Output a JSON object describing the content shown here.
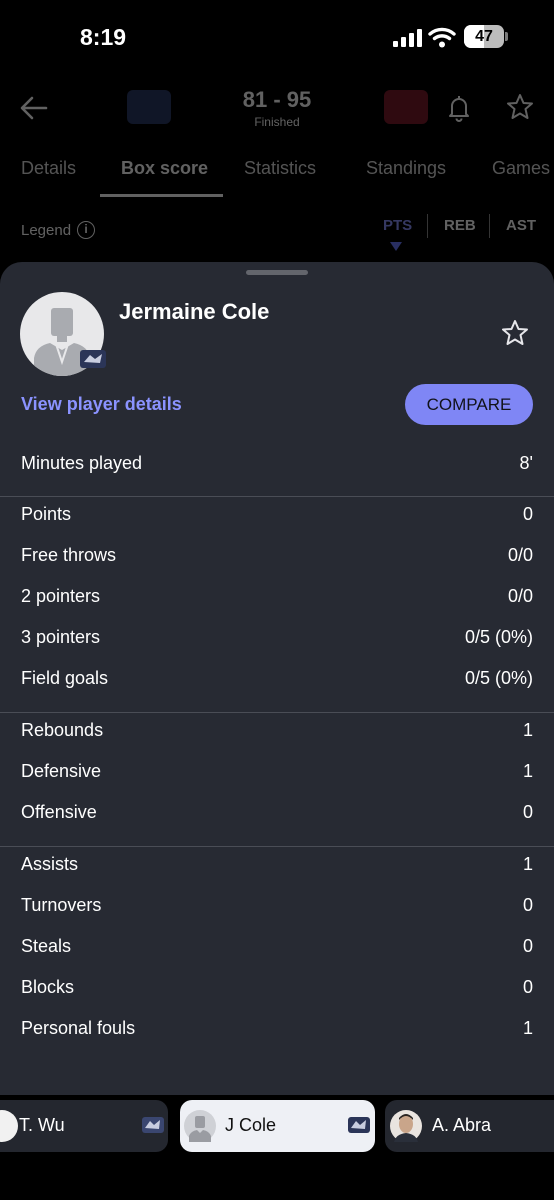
{
  "status_bar": {
    "time": "8:19",
    "battery": "47"
  },
  "header": {
    "home_score": "81",
    "away_score": "95",
    "score_display": "81 - 95",
    "status": "Finished",
    "icons": [
      "back-arrow-icon",
      "bell-icon",
      "star-icon"
    ]
  },
  "tabs": [
    "Details",
    "Box score",
    "Statistics",
    "Standings",
    "Games"
  ],
  "active_tab": "Box score",
  "legend": {
    "label": "Legend",
    "info_icon": "i"
  },
  "stat_toggles": [
    "PTS",
    "REB",
    "AST"
  ],
  "player": {
    "name": "Jermaine Cole",
    "view_details": "View player details",
    "compare": "COMPARE"
  },
  "stats": {
    "minutes": {
      "label": "Minutes played",
      "value": "8'"
    },
    "scoring": [
      {
        "label": "Points",
        "value": "0"
      },
      {
        "label": "Free throws",
        "value": "0/0"
      },
      {
        "label": "2 pointers",
        "value": "0/0"
      },
      {
        "label": "3 pointers",
        "value": "0/5 (0%)"
      },
      {
        "label": "Field goals",
        "value": "0/5 (0%)"
      }
    ],
    "rebounding": [
      {
        "label": "Rebounds",
        "value": "1"
      },
      {
        "label": "Defensive",
        "value": "1"
      },
      {
        "label": "Offensive",
        "value": "0"
      }
    ],
    "other": [
      {
        "label": "Assists",
        "value": "1"
      },
      {
        "label": "Turnovers",
        "value": "0"
      },
      {
        "label": "Steals",
        "value": "0"
      },
      {
        "label": "Blocks",
        "value": "0"
      },
      {
        "label": "Personal fouls",
        "value": "1"
      }
    ]
  },
  "switcher": [
    {
      "name": "T. Wu"
    },
    {
      "name": "J Cole"
    },
    {
      "name": "A. Abra"
    }
  ],
  "colors": {
    "accent": "#7f86f5",
    "link": "#8b93ff",
    "sheet": "#272a33"
  }
}
